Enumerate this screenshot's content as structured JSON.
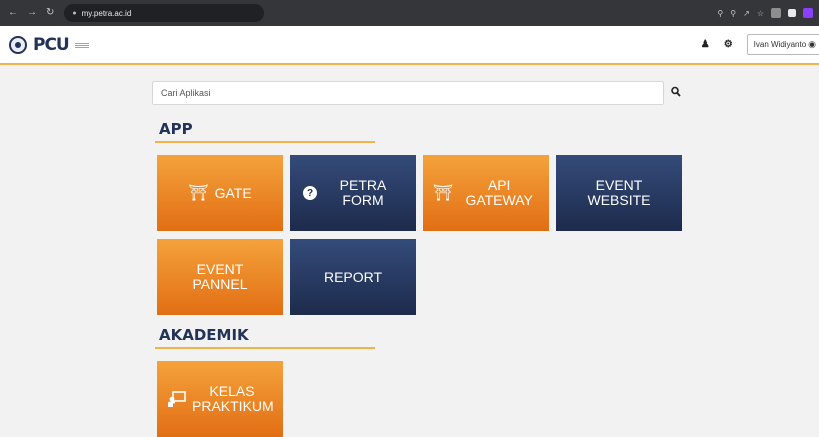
{
  "browser": {
    "url": "my.petra.ac.id",
    "nav_icons": [
      "back-icon",
      "forward-icon",
      "reload-icon"
    ]
  },
  "header": {
    "logo_text": "PCU",
    "user_name": "Ivan Widiyanto",
    "icons": [
      "user-icon",
      "gears-icon"
    ]
  },
  "search": {
    "placeholder": "Cari Aplikasi"
  },
  "sections": {
    "app": {
      "title": "APP"
    },
    "akademik": {
      "title": "AKADEMIK"
    }
  },
  "tiles": {
    "gate": {
      "label": "GATE",
      "color": "orange",
      "icon": "torii-gate-icon"
    },
    "petra_form": {
      "label": "PETRA FORM",
      "color": "navy",
      "icon": "question-circle-icon"
    },
    "api_gateway": {
      "label": "API GATEWAY",
      "color": "orange",
      "icon": "torii-gate-icon"
    },
    "event_website": {
      "label": "EVENT WEBSITE",
      "color": "navy"
    },
    "event_pannel": {
      "label": "EVENT PANNEL",
      "color": "orange"
    },
    "report": {
      "label": "REPORT",
      "color": "navy"
    },
    "kelas_praktikum": {
      "label": "KELAS PRAKTIKUM",
      "color": "orange",
      "icon": "chalkboard-teacher-icon"
    }
  },
  "colors": {
    "orange_top": "#f4a23c",
    "orange_bottom": "#e26e14",
    "navy_top": "#344b7a",
    "navy_bottom": "#1d2b4c",
    "accent": "#f1b34a",
    "heading": "#223357"
  }
}
